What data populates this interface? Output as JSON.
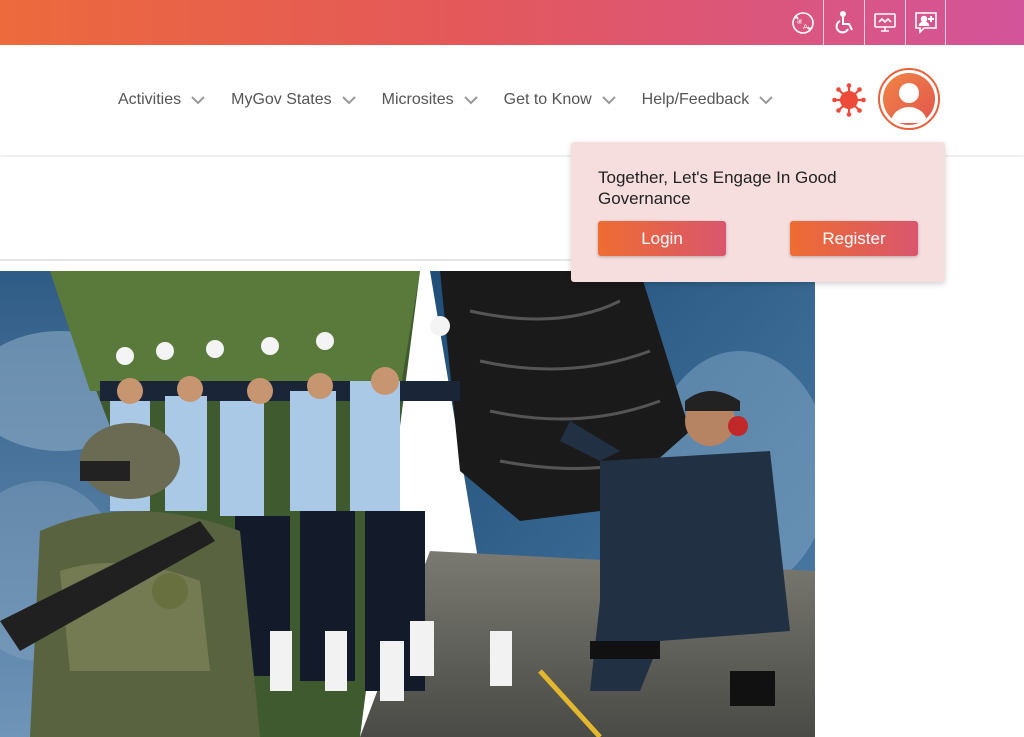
{
  "topbar": {
    "icons": [
      "language-translate-icon",
      "accessibility-icon",
      "screen-reader-icon",
      "add-user-icon"
    ]
  },
  "nav": {
    "items": [
      {
        "label": "Activities"
      },
      {
        "label": "MyGov States"
      },
      {
        "label": "Microsites"
      },
      {
        "label": "Get to Know"
      },
      {
        "label": "Help/Feedback"
      }
    ]
  },
  "popup": {
    "message": "Together, Let's Engage In Good Governance",
    "login_label": "Login",
    "register_label": "Register"
  },
  "colors": {
    "brand_orange": "#ec6a3c",
    "brand_pink": "#d3549a",
    "popup_bg": "#f6dede"
  }
}
